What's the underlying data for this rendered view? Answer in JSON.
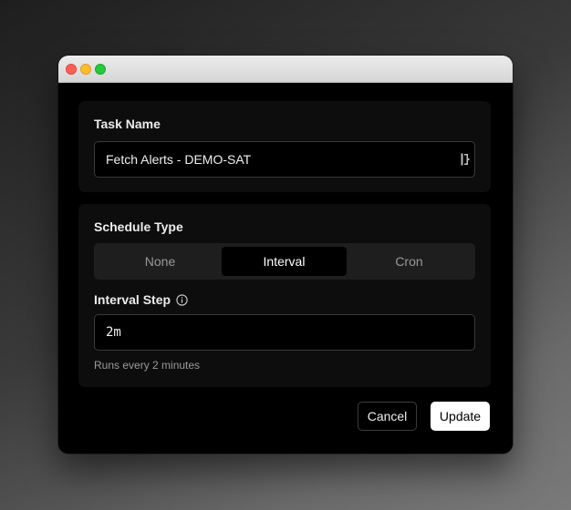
{
  "window": {
    "controls": [
      "close",
      "minimize",
      "maximize"
    ]
  },
  "task_name": {
    "label": "Task Name",
    "value": "Fetch Alerts - DEMO-SAT",
    "icon": "password-manager-icon"
  },
  "schedule_type": {
    "label": "Schedule Type",
    "options": [
      "None",
      "Interval",
      "Cron"
    ],
    "selected": "Interval"
  },
  "interval_step": {
    "label": "Interval Step",
    "info_icon": "info-icon",
    "value": "2m",
    "helper": "Runs every 2 minutes"
  },
  "actions": {
    "cancel_label": "Cancel",
    "update_label": "Update"
  },
  "colors": {
    "close": "#fe5f57",
    "minimize": "#febc2e",
    "maximize": "#28c840",
    "card": "#0d0d0d",
    "segment_bg": "#1e1e1e",
    "primary_button": "#ffffff"
  }
}
